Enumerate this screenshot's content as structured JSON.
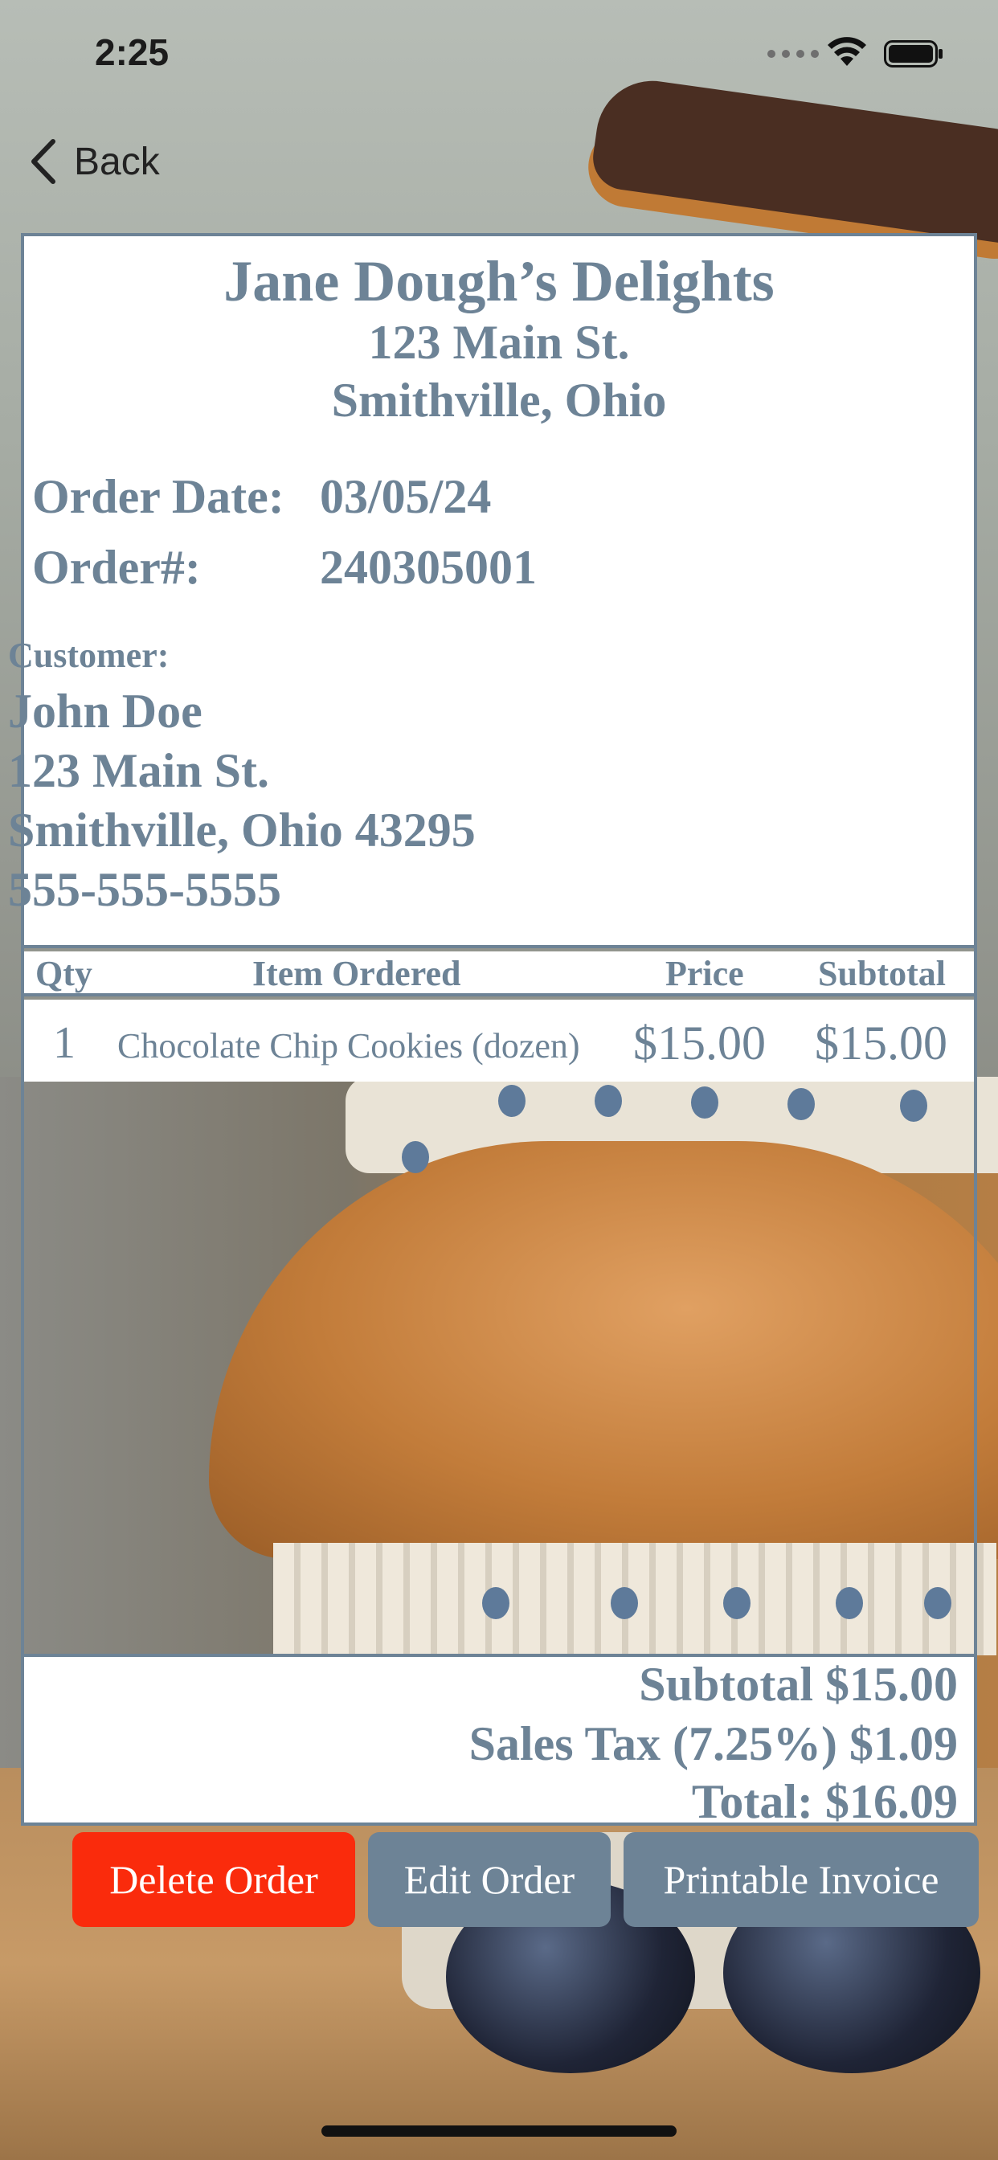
{
  "status_bar": {
    "time": "2:25"
  },
  "nav": {
    "back_label": "Back"
  },
  "business": {
    "name": "Jane Dough’s Delights",
    "address_line1": "123 Main St.",
    "address_line2": "Smithville, Ohio"
  },
  "order": {
    "date_label": "Order Date:",
    "date_value": "03/05/24",
    "number_label": "Order#:",
    "number_value": "240305001"
  },
  "customer": {
    "label": "Customer:",
    "name": "John Doe",
    "address_line1": "123 Main St.",
    "address_line2": "Smithville, Ohio 43295",
    "phone": "555-555-5555"
  },
  "table": {
    "headers": {
      "qty": "Qty",
      "item": "Item Ordered",
      "price": "Price",
      "subtotal": "Subtotal"
    },
    "rows": [
      {
        "qty": "1",
        "item": "Chocolate Chip Cookies (dozen)",
        "price": "$15.00",
        "subtotal": "$15.00"
      }
    ]
  },
  "totals": {
    "subtotal": "Subtotal $15.00",
    "sales_tax": "Sales Tax (7.25%) $1.09",
    "total": "Total: $16.09"
  },
  "buttons": {
    "delete": "Delete Order",
    "edit": "Edit Order",
    "print": "Printable Invoice"
  },
  "colors": {
    "accent": "#6d8396",
    "delete": "#fa2b0c",
    "card_background": "#ffffff"
  }
}
